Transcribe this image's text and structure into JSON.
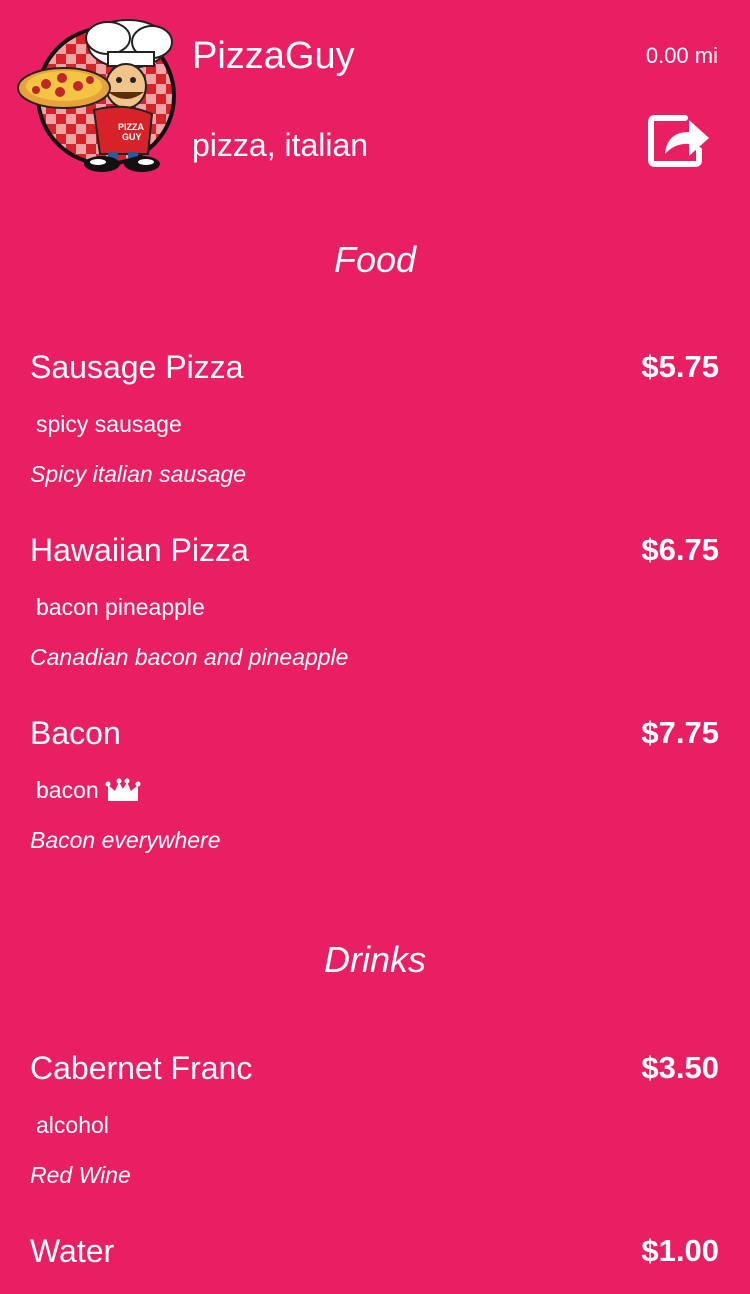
{
  "vendor": {
    "name": "PizzaGuy",
    "tags": "pizza, italian",
    "distance": "0.00 mi",
    "logo_icon": "pizza-chef-logo",
    "logo_text_line1": "PIZZA",
    "logo_text_line2": "GUY"
  },
  "share": {
    "icon": "share-icon"
  },
  "colors": {
    "background": "#EA1F63",
    "text": "#FFFFFF"
  },
  "sections": [
    {
      "title": "Food",
      "items": [
        {
          "name": "Sausage Pizza",
          "price": "$5.75",
          "tags": "spicy sausage",
          "description": "Spicy italian sausage"
        },
        {
          "name": "Hawaiian Pizza",
          "price": "$6.75",
          "tags": "bacon pineapple",
          "description": "Canadian bacon and pineapple"
        },
        {
          "name": "Bacon",
          "price": "$7.75",
          "tags": "bacon",
          "tag_icon": "crown-icon",
          "description": "Bacon everywhere"
        }
      ]
    },
    {
      "title": "Drinks",
      "items": [
        {
          "name": "Cabernet Franc",
          "price": "$3.50",
          "tags": "alcohol",
          "description": "Red Wine"
        },
        {
          "name": "Water",
          "price": "$1.00",
          "tags": "",
          "description": ""
        }
      ]
    }
  ]
}
